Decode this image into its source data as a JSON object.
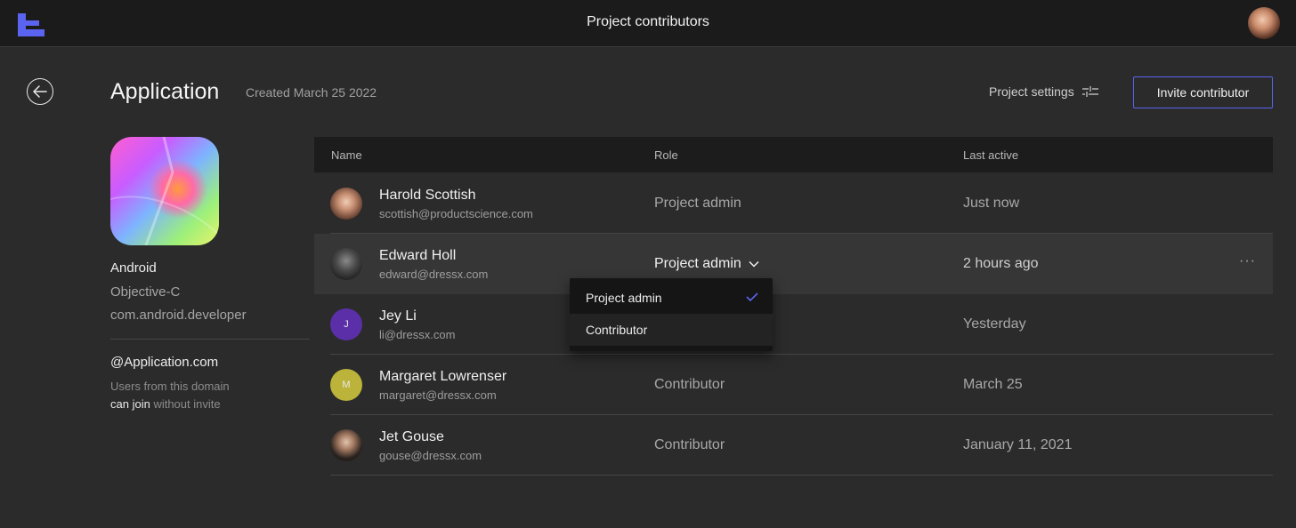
{
  "topbar": {
    "title": "Project contributors"
  },
  "header": {
    "title": "Application",
    "created": "Created March 25 2022",
    "settings_label": "Project settings",
    "invite_label": "Invite contributor"
  },
  "app": {
    "platform": "Android",
    "language": "Objective-C",
    "package": "com.android.developer"
  },
  "domain": {
    "name": "@Application.com",
    "note_before": "Users from this domain",
    "note_strong": "can join",
    "note_after": "without invite"
  },
  "table": {
    "columns": [
      "Name",
      "Role",
      "Last active"
    ],
    "rows": [
      {
        "name": "Harold Scottish",
        "email": "scottish@productscience.com",
        "role": "Project admin",
        "last_active": "Just now"
      },
      {
        "name": "Edward Holl",
        "email": "edward@dressx.com",
        "role": "Project admin",
        "last_active": "2 hours ago"
      },
      {
        "name": "Jey Li",
        "email": "li@dressx.com",
        "role": "",
        "last_active": "Yesterday",
        "initial": "J"
      },
      {
        "name": "Margaret Lowrenser",
        "email": "margaret@dressx.com",
        "role": "Contributor",
        "last_active": "March 25",
        "initial": "M"
      },
      {
        "name": "Jet Gouse",
        "email": "gouse@dressx.com",
        "role": "Contributor",
        "last_active": "January 11, 2021"
      }
    ]
  },
  "more_label": "···",
  "dropdown": {
    "options": [
      "Project admin",
      "Contributor"
    ],
    "selected": "Project admin"
  },
  "colors": {
    "accent": "#5a64f0",
    "background": "#2b2b2b",
    "topbar": "#1b1b1b",
    "avatar_jey": "#5b2fa8",
    "avatar_margaret": "#bcb33a"
  },
  "icons": {
    "logo": "logo-icon",
    "back": "arrow-left-icon",
    "settings": "sliders-icon",
    "chevron": "chevron-down-icon",
    "check": "check-icon",
    "more": "more-horizontal-icon"
  }
}
